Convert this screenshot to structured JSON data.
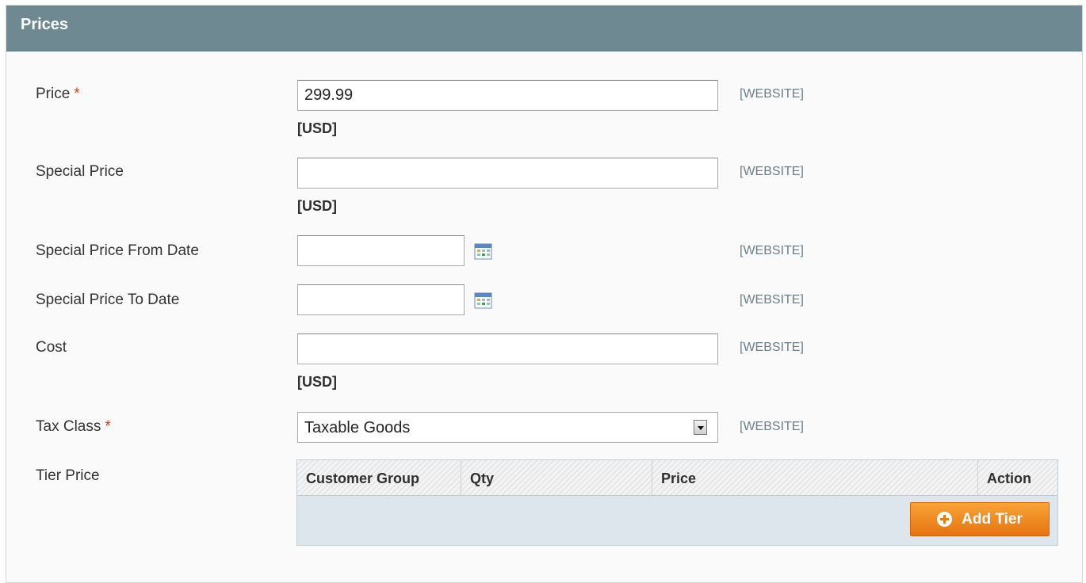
{
  "section": {
    "title": "Prices"
  },
  "fields": {
    "price": {
      "label": "Price",
      "required_mark": "*",
      "value": "299.99",
      "currency": "[USD]",
      "scope": "[WEBSITE]"
    },
    "special_price": {
      "label": "Special Price",
      "value": "",
      "currency": "[USD]",
      "scope": "[WEBSITE]"
    },
    "special_from": {
      "label": "Special Price From Date",
      "value": "",
      "scope": "[WEBSITE]"
    },
    "special_to": {
      "label": "Special Price To Date",
      "value": "",
      "scope": "[WEBSITE]"
    },
    "cost": {
      "label": "Cost",
      "value": "",
      "currency": "[USD]",
      "scope": "[WEBSITE]"
    },
    "tax_class": {
      "label": "Tax Class",
      "required_mark": "*",
      "selected": "Taxable Goods",
      "scope": "[WEBSITE]"
    },
    "tier_price": {
      "label": "Tier Price",
      "columns": [
        "Customer Group",
        "Qty",
        "Price",
        "Action"
      ],
      "add_label": "Add Tier"
    }
  },
  "icons": {
    "calendar": "calendar-icon",
    "add": "plus-circle-icon",
    "dropdown": "chevron-down-icon"
  },
  "colors": {
    "header": "#6f8992",
    "accent_button": "#f39a2a",
    "required": "#eb340a"
  }
}
